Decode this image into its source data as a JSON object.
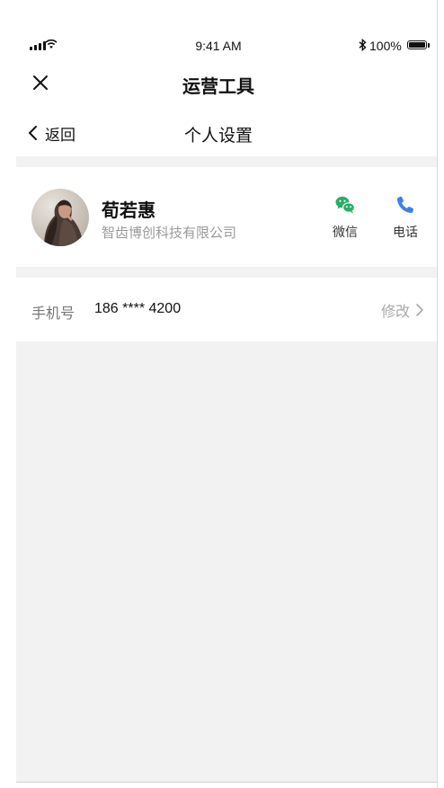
{
  "status_bar": {
    "time": "9:41 AM",
    "battery_percent": "100%"
  },
  "header": {
    "title": "运营工具",
    "close_icon": "close-icon"
  },
  "subnav": {
    "back_label": "返回",
    "title": "个人设置"
  },
  "profile": {
    "name": "荀若惠",
    "company": "智齿博创科技有限公司",
    "contacts": [
      {
        "label": "微信",
        "icon": "wechat-icon",
        "color": "#2aae67"
      },
      {
        "label": "电话",
        "icon": "phone-icon",
        "color": "#3b82e6"
      }
    ]
  },
  "phone_row": {
    "label": "手机号",
    "value": "186 **** 4200",
    "action_label": "修改"
  }
}
